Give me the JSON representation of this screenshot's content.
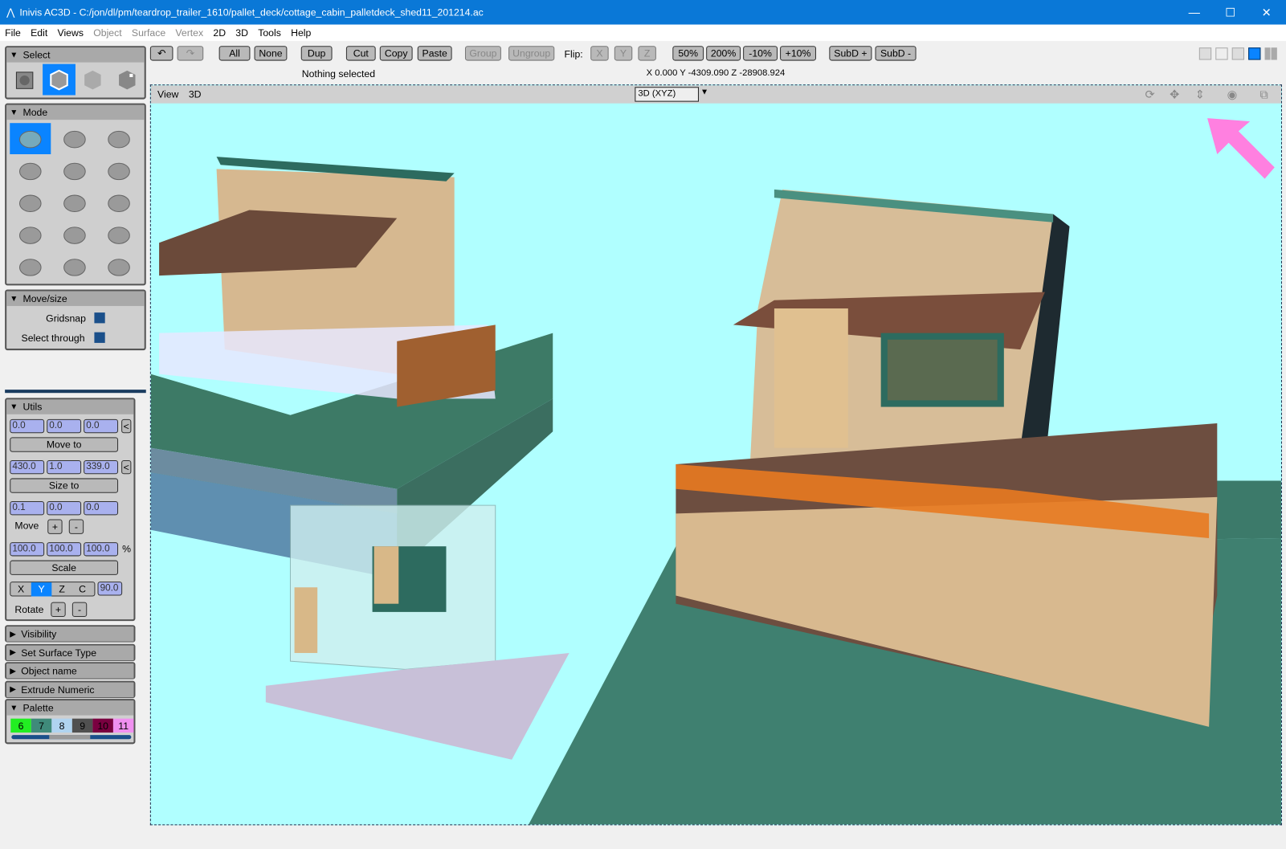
{
  "window": {
    "title": "Inivis AC3D - C:/jon/dl/pm/teardrop_trailer_1610/pallet_deck/cottage_cabin_palletdeck_shed11_201214.ac",
    "minimize": "—",
    "maximize": "☐",
    "close": "✕"
  },
  "menu": [
    {
      "label": "File",
      "enabled": true
    },
    {
      "label": "Edit",
      "enabled": true
    },
    {
      "label": "Views",
      "enabled": true
    },
    {
      "label": "Object",
      "enabled": false
    },
    {
      "label": "Surface",
      "enabled": false
    },
    {
      "label": "Vertex",
      "enabled": false
    },
    {
      "label": "2D",
      "enabled": true
    },
    {
      "label": "3D",
      "enabled": true
    },
    {
      "label": "Tools",
      "enabled": true
    },
    {
      "label": "Help",
      "enabled": true
    }
  ],
  "toolbar": {
    "undo": "↶",
    "redo": "↷",
    "all": "All",
    "none": "None",
    "dup": "Dup",
    "cut": "Cut",
    "copy": "Copy",
    "paste": "Paste",
    "group": "Group",
    "ungroup": "Ungroup",
    "flip_label": "Flip:",
    "flip_x": "X",
    "flip_y": "Y",
    "flip_z": "Z",
    "p50": "50%",
    "p200": "200%",
    "m10": "-10%",
    "p10": "+10%",
    "subd_plus": "SubD +",
    "subd_minus": "SubD -"
  },
  "status": {
    "selection": "Nothing selected",
    "coords": "X 0.000 Y -4309.090 Z -28908.924"
  },
  "select_panel": {
    "title": "Select",
    "selected_index": 1
  },
  "mode_panel": {
    "title": "Mode",
    "selected_index": 0
  },
  "movesize": {
    "title": "Move/size",
    "gridsnap": "Gridsnap",
    "select_through": "Select through",
    "gridsnap_checked": true,
    "select_through_checked": true
  },
  "utils": {
    "title": "Utils",
    "pos": [
      "0.0",
      "0.0",
      "0.0"
    ],
    "move_to": "Move to",
    "size": [
      "430.0",
      "1.0",
      "339.0"
    ],
    "size_to": "Size to",
    "delta": [
      "0.1",
      "0.0",
      "0.0"
    ],
    "move": "Move",
    "plus": "+",
    "minus": "-",
    "scale": [
      "100.0",
      "100.0",
      "100.0"
    ],
    "pct": "%",
    "scale_btn": "Scale",
    "axes": [
      "X",
      "Y",
      "Z",
      "C"
    ],
    "axis_selected": "Y",
    "angle": "90.0",
    "rotate": "Rotate",
    "back": "<"
  },
  "collapsed": [
    "Visibility",
    "Set Surface Type",
    "Object name",
    "Extrude Numeric"
  ],
  "palette": {
    "title": "Palette",
    "swatches": [
      {
        "n": "6",
        "c": "#22ee22"
      },
      {
        "n": "7",
        "c": "#3f8a7a"
      },
      {
        "n": "8",
        "c": "#b0d4f0"
      },
      {
        "n": "9",
        "c": "#505050"
      },
      {
        "n": "10",
        "c": "#7a0040"
      },
      {
        "n": "11",
        "c": "#f090f0"
      }
    ]
  },
  "viewport": {
    "menu_view": "View",
    "menu_3d": "3D",
    "projection": "3D (XYZ)",
    "background": "#b0ffff"
  }
}
